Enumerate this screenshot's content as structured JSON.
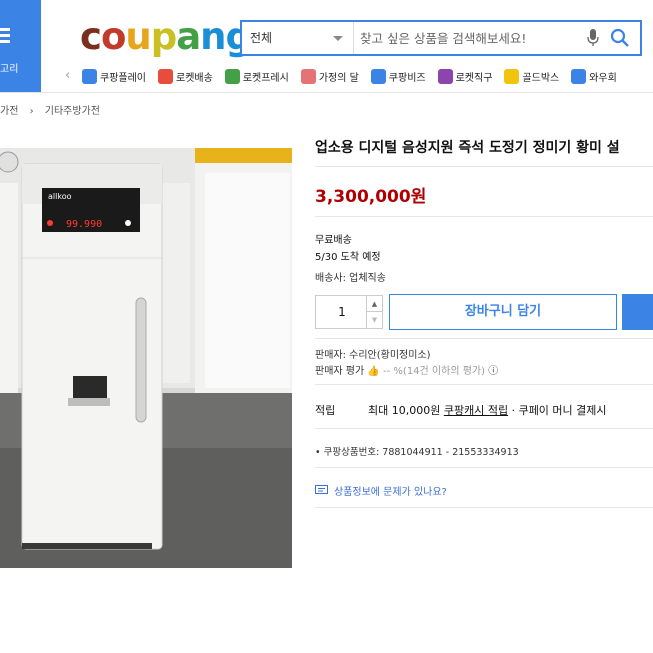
{
  "header": {
    "category_label": "고리",
    "logo_letters": [
      "c",
      "o",
      "u",
      "p",
      "a",
      "n",
      "g"
    ],
    "logo_colors": [
      "#7a2e1c",
      "#c23a2b",
      "#e6a51b",
      "#c9c025",
      "#43a047",
      "#1a8fd6",
      "#1a8fd6"
    ],
    "search": {
      "category": "전체",
      "placeholder": "찾고 싶은 상품을 검색해보세요!"
    }
  },
  "quick_links": [
    {
      "label": "쿠팡플레이",
      "icon": "play-icon",
      "color": "#3b84e6"
    },
    {
      "label": "로켓배송",
      "icon": "rocket-icon",
      "color": "#e74c3c"
    },
    {
      "label": "로켓프레시",
      "icon": "rocket-fresh-icon",
      "color": "#43a047"
    },
    {
      "label": "가정의 달",
      "icon": "family-icon",
      "color": "#e57373"
    },
    {
      "label": "쿠팡비즈",
      "icon": "biz-icon",
      "color": "#3b84e6"
    },
    {
      "label": "로켓직구",
      "icon": "global-icon",
      "color": "#8e44ad"
    },
    {
      "label": "골드박스",
      "icon": "goldbox-icon",
      "color": "#f1c40f"
    },
    {
      "label": "와우회",
      "icon": "wow-icon",
      "color": "#3b84e6"
    }
  ],
  "breadcrumb": [
    "가전",
    "기타주방가전"
  ],
  "product": {
    "title": "업소용 디지털 음성지원 즉석 도정기 정미기 황미 설",
    "price": "3,300,000원",
    "shipping_free": "무료배송",
    "delivery_eta": "5/30 도착 예정",
    "carrier": "배송사: 업체직송",
    "quantity": "1",
    "cart_button": "장바구니 담기",
    "seller": "판매자: 수리안(황미정미소)",
    "seller_rating_label": "판매자 평가",
    "seller_rating_value": "-- %(14건 이하의 평가)",
    "reward_label": "적립",
    "reward_prefix": "최대 10,000원",
    "reward_link": "쿠팡캐시 적립",
    "reward_suffix": "· 쿠페이 머니 결제시",
    "product_code": "쿠팡상품번호: 7881044911 - 21553334913",
    "report_link": "상품정보에 문제가 있나요?",
    "machine_brand": "allkoo",
    "machine_display": "99.990",
    "accent_color": "#3b84e6",
    "price_color": "#ae0000"
  }
}
